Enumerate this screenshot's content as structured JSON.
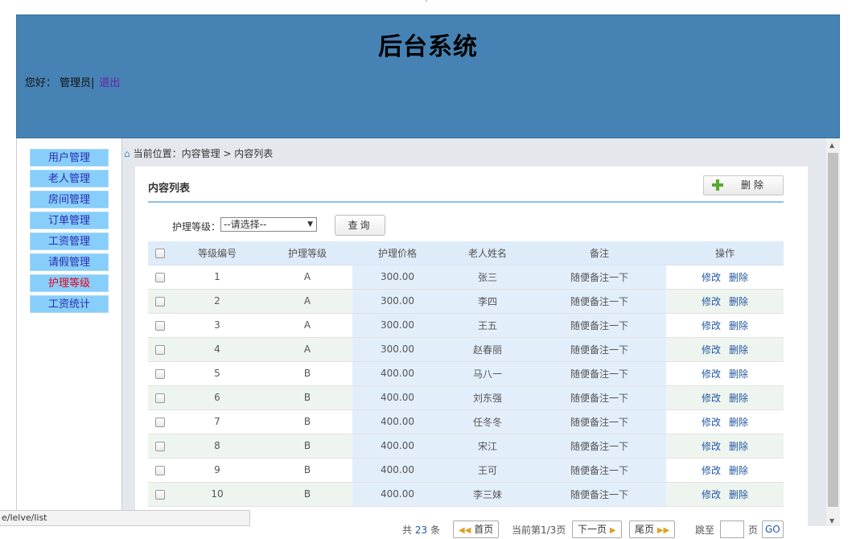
{
  "top_mark": "`",
  "header": {
    "title": "后台系统",
    "greeting": "您好：",
    "user": "管理员|",
    "logout": "退出"
  },
  "sidebar": {
    "items": [
      {
        "label": "用户管理"
      },
      {
        "label": "老人管理"
      },
      {
        "label": "房间管理"
      },
      {
        "label": "订单管理"
      },
      {
        "label": "工资管理"
      },
      {
        "label": "请假管理"
      },
      {
        "label": "护理等级"
      },
      {
        "label": "工资统计"
      }
    ],
    "active_index": 6
  },
  "breadcrumb": "当前位置：内容管理 > 内容列表",
  "panel": {
    "title": "内容列表",
    "delete_button": "删除"
  },
  "filter": {
    "label": "护理等级：",
    "select_value": "--请选择--",
    "query_button": "查询"
  },
  "table": {
    "headers": [
      "",
      "等级编号",
      "护理等级",
      "护理价格",
      "老人姓名",
      "备注",
      "操作"
    ],
    "action_edit": "修改",
    "action_delete": "删除",
    "rows": [
      {
        "id": "1",
        "level": "A",
        "price": "300.00",
        "name": "张三",
        "note": "随便备注一下"
      },
      {
        "id": "2",
        "level": "A",
        "price": "300.00",
        "name": "李四",
        "note": "随便备注一下"
      },
      {
        "id": "3",
        "level": "A",
        "price": "300.00",
        "name": "王五",
        "note": "随便备注一下"
      },
      {
        "id": "4",
        "level": "A",
        "price": "300.00",
        "name": "赵春丽",
        "note": "随便备注一下"
      },
      {
        "id": "5",
        "level": "B",
        "price": "400.00",
        "name": "马八一",
        "note": "随便备注一下"
      },
      {
        "id": "6",
        "level": "B",
        "price": "400.00",
        "name": "刘东强",
        "note": "随便备注一下"
      },
      {
        "id": "7",
        "level": "B",
        "price": "400.00",
        "name": "任冬冬",
        "note": "随便备注一下"
      },
      {
        "id": "8",
        "level": "B",
        "price": "400.00",
        "name": "宋江",
        "note": "随便备注一下"
      },
      {
        "id": "9",
        "level": "B",
        "price": "400.00",
        "name": "王可",
        "note": "随便备注一下"
      },
      {
        "id": "10",
        "level": "B",
        "price": "400.00",
        "name": "李三妹",
        "note": "随便备注一下"
      }
    ]
  },
  "pager": {
    "total_prefix": "共",
    "total": "23",
    "total_suffix": "条",
    "first": "首页",
    "current": "当前第1/3页",
    "next": "下一页",
    "last": "尾页",
    "goto": "跳至",
    "page_unit": "页",
    "go": "GO"
  },
  "statusbar": "e/lelve/list",
  "colors": {
    "header_bg": "#4682b4",
    "sidebar_item_bg": "#87cefa",
    "active_item": "#e6001a",
    "link": "#2356a6"
  }
}
